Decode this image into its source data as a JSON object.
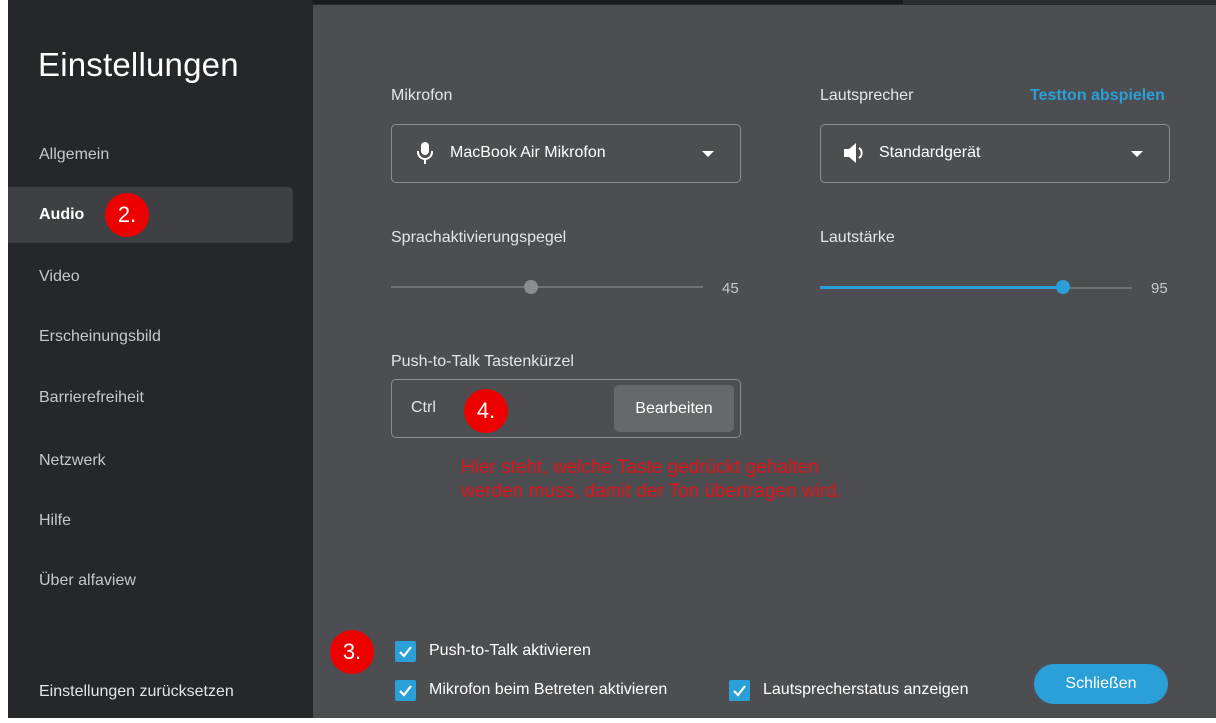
{
  "sidebar": {
    "title": "Einstellungen",
    "items": [
      {
        "label": "Allgemein"
      },
      {
        "label": "Audio"
      },
      {
        "label": "Video"
      },
      {
        "label": "Erscheinungsbild"
      },
      {
        "label": "Barrierefreiheit"
      },
      {
        "label": "Netzwerk"
      },
      {
        "label": "Hilfe"
      },
      {
        "label": "Über alfaview"
      }
    ],
    "active_item": "Audio",
    "reset_label": "Einstellungen zurücksetzen"
  },
  "audio": {
    "microphone": {
      "label": "Mikrofon",
      "value": "MacBook Air Mikrofon",
      "icon": "microphone-icon"
    },
    "speaker": {
      "label": "Lautsprecher",
      "test_link": "Testton abspielen",
      "value": "Standardgerät",
      "icon": "speaker-icon"
    },
    "voice_activation": {
      "label": "Sprachaktivierungspegel",
      "value": "45",
      "fraction": 0.45
    },
    "volume": {
      "label": "Lautstärke",
      "value": "95",
      "fraction": 0.78
    },
    "push_to_talk": {
      "label": "Push-to-Talk Tastenkürzel",
      "key": "Ctrl",
      "edit_label": "Bearbeiten"
    },
    "checkboxes": {
      "ptt_enable": {
        "label": "Push-to-Talk aktivieren",
        "checked": true
      },
      "mic_on_join": {
        "label": "Mikrofon beim Betreten aktivieren",
        "checked": true
      },
      "speaker_status": {
        "label": "Lautsprecherstatus anzeigen",
        "checked": true
      }
    },
    "close_label": "Schließen"
  },
  "annotations": {
    "badge_audio": "2.",
    "badge_checkbox": "3.",
    "badge_key": "4.",
    "note": "Hier steht, welche Taste gedrückt gehalten werden muss, damit der Ton übertragen wird."
  },
  "colors": {
    "accent": "#2b9fd8",
    "sidebar_bg": "#25272b",
    "content_bg": "#4c4e52",
    "annotation_red": "#e0141b",
    "badge_red": "#ee0000"
  }
}
